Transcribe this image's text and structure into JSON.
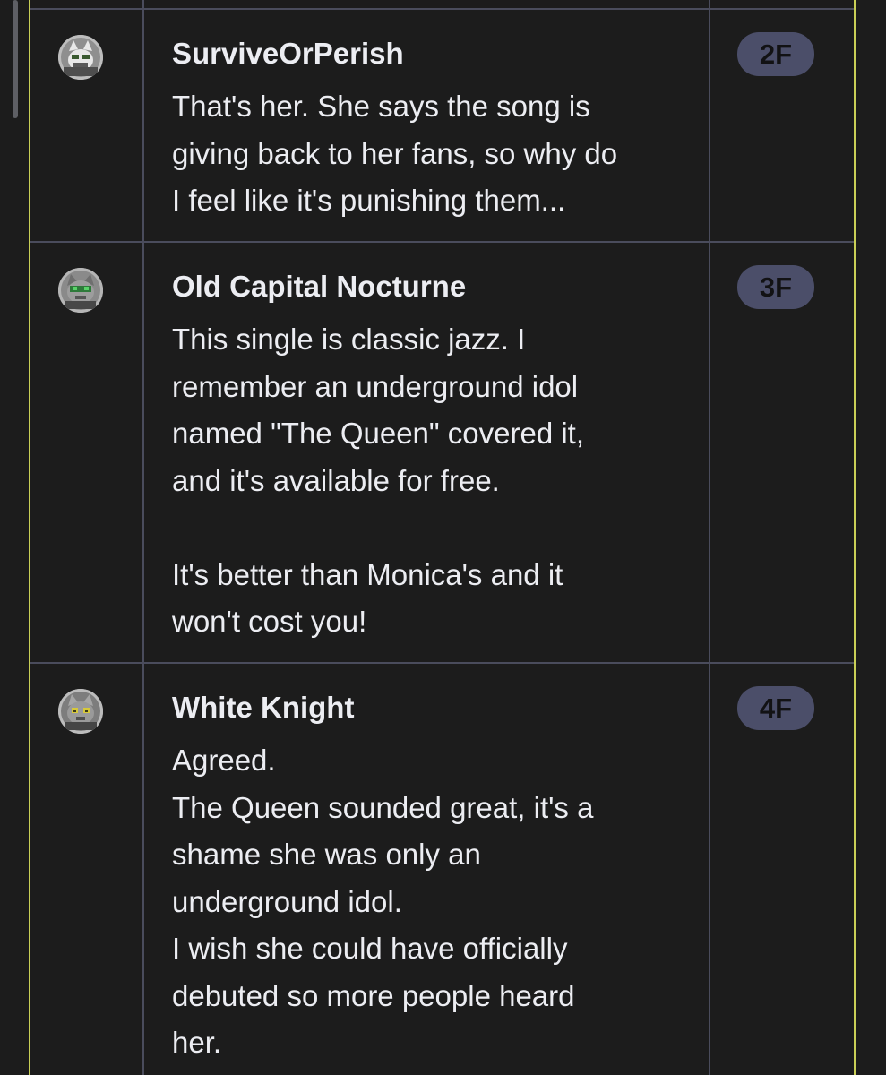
{
  "thread": {
    "posts": [
      {
        "username": "SurviveOrPerish",
        "floor": "2F",
        "avatar_icon": "white-cat-avatar-icon",
        "message_lines": [
          "That's her. She says the song is",
          "giving back to her fans, so why do",
          "I feel like it's punishing them..."
        ]
      },
      {
        "username": "Old Capital Nocturne",
        "floor": "3F",
        "avatar_icon": "green-eyed-cat-avatar-icon",
        "message_lines": [
          "This single is classic jazz. I",
          "remember an underground idol",
          "named \"The Queen\" covered it,",
          "and it's available for free.",
          "",
          "It's better than Monica's and it",
          "won't cost you!"
        ]
      },
      {
        "username": "White Knight",
        "floor": "4F",
        "avatar_icon": "yellow-eyed-cat-avatar-icon",
        "message_lines": [
          "Agreed.",
          "The Queen sounded great, it's a",
          "shame she was only an",
          "underground idol.",
          "I wish she could have officially",
          "debuted so more people heard",
          "her."
        ]
      }
    ]
  },
  "colors": {
    "background": "#1c1c1c",
    "thread_border": "#c9cf56",
    "grid_line": "#4a4c5c",
    "badge_background": "#4b4e69",
    "badge_text": "#121214",
    "text": "#ecedf2"
  }
}
